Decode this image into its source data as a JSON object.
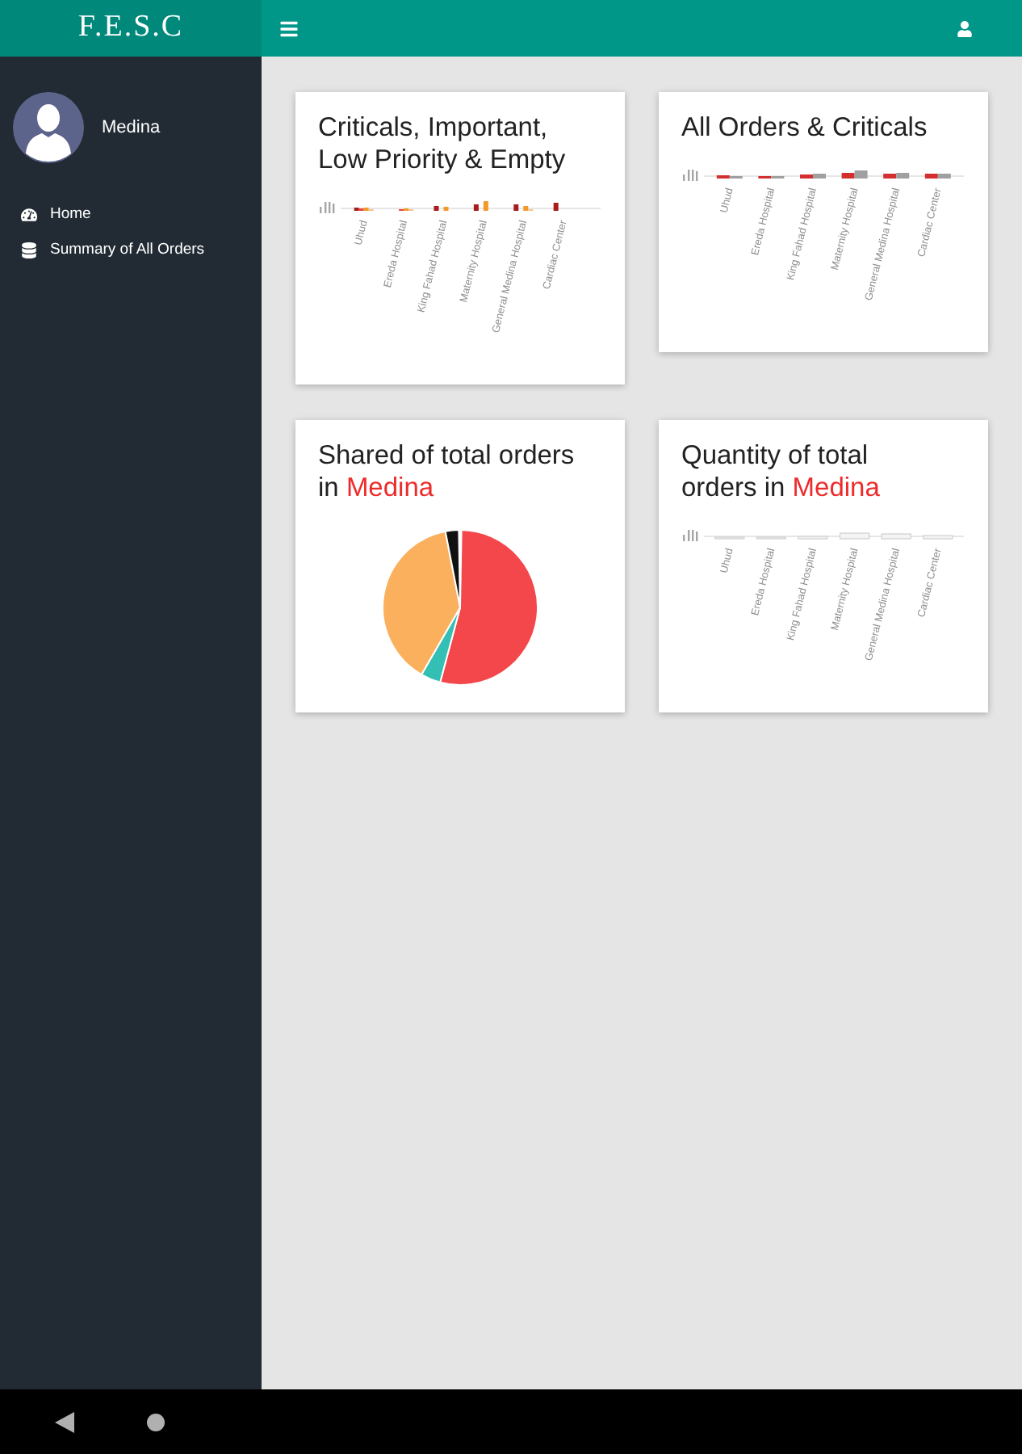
{
  "header": {
    "title": "F.E.S.C"
  },
  "sidebar": {
    "user": {
      "name": "Medina"
    },
    "items": [
      {
        "label": "Home"
      },
      {
        "label": "Summary of All Orders"
      }
    ]
  },
  "cards": [
    {
      "kind": "priority",
      "title": "Criticals, Important, Low Priority & Empty",
      "axis_labels": [
        "Uhud",
        "Ereda Hospital",
        "King Fahad Hospital",
        "Maternity Hospital",
        "General Medina Hospital",
        "Cardiac Center"
      ]
    },
    {
      "kind": "orders",
      "title": "All Orders & Criticals",
      "axis_labels": [
        "Uhud",
        "Ereda Hospital",
        "King Fahad Hospital",
        "Maternity Hospital",
        "General Medina Hospital",
        "Cardiac Center"
      ]
    },
    {
      "kind": "share",
      "title": "Shared of total orders in",
      "title_highlight": "Medina"
    },
    {
      "kind": "quantity",
      "title": "Quantity of total orders in",
      "title_highlight": "Medina",
      "axis_labels": [
        "Uhud",
        "Ereda Hospital",
        "King Fahad Hospital",
        "Maternity Hospital",
        "General Medina Hospital",
        "Cardiac Center"
      ]
    }
  ]
}
